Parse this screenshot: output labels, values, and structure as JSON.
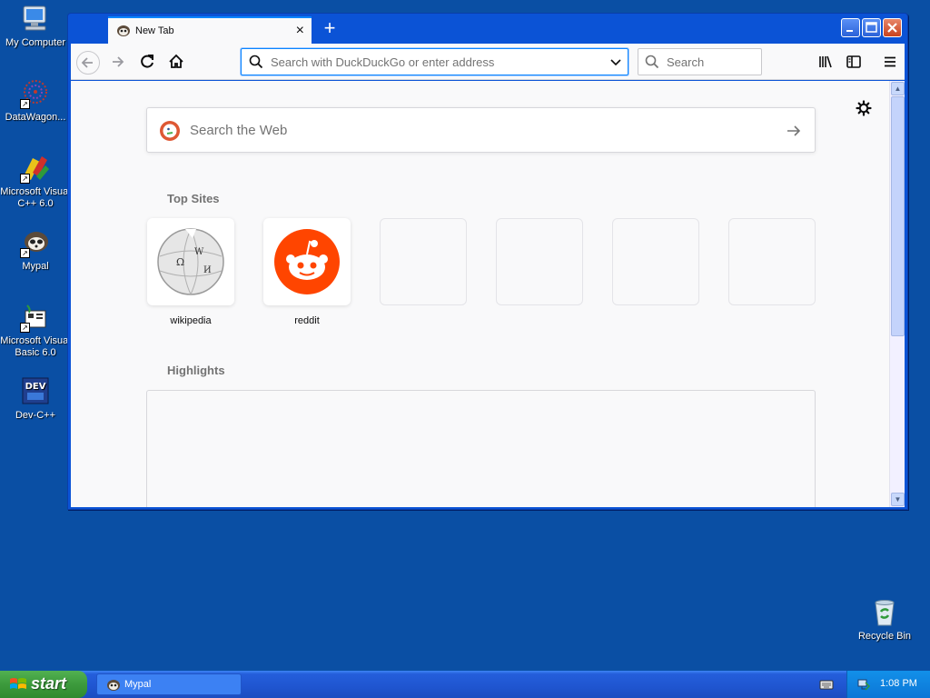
{
  "desktop": {
    "icons": [
      {
        "label": "My Computer",
        "icon": "computer-icon"
      },
      {
        "label": "DataWagon...",
        "icon": "datawagon-icon"
      },
      {
        "label": "Microsoft Visual C++ 6.0",
        "icon": "visual-cpp-icon"
      },
      {
        "label": "Mypal",
        "icon": "mypal-icon"
      },
      {
        "label": "Microsoft Visual Basic 6.0",
        "icon": "visual-basic-icon"
      },
      {
        "label": "Dev-C++",
        "icon": "dev-cpp-icon"
      },
      {
        "label": "Recycle Bin",
        "icon": "recycle-bin-icon"
      }
    ]
  },
  "browser": {
    "tab_title": "New Tab",
    "new_tab_symbol": "+",
    "url_placeholder": "Search with DuckDuckGo or enter address",
    "search_placeholder": "Search",
    "web_search_placeholder": "Search the Web",
    "top_sites_heading": "Top Sites",
    "highlights_heading": "Highlights",
    "top_sites": [
      {
        "label": "wikipedia",
        "icon": "wikipedia-globe-icon"
      },
      {
        "label": "reddit",
        "icon": "reddit-alien-icon"
      },
      {
        "label": "",
        "icon": ""
      },
      {
        "label": "",
        "icon": ""
      },
      {
        "label": "",
        "icon": ""
      },
      {
        "label": "",
        "icon": ""
      }
    ]
  },
  "taskbar": {
    "start_label": "start",
    "task_label": "Mypal",
    "clock": "1:08 PM"
  },
  "colors": {
    "desktop_bg": "#0a4fa4",
    "accent": "#0a84ff",
    "reddit": "#ff4500"
  }
}
